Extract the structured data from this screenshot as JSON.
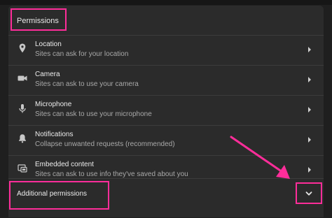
{
  "section": {
    "title": "Permissions"
  },
  "permissions": [
    {
      "title": "Location",
      "desc": "Sites can ask for your location",
      "icon": "location-pin-icon"
    },
    {
      "title": "Camera",
      "desc": "Sites can ask to use your camera",
      "icon": "camera-icon"
    },
    {
      "title": "Microphone",
      "desc": "Sites can ask to use your microphone",
      "icon": "microphone-icon"
    },
    {
      "title": "Notifications",
      "desc": "Collapse unwanted requests (recommended)",
      "icon": "bell-icon"
    },
    {
      "title": "Embedded content",
      "desc": "Sites can ask to use info they've saved about you",
      "icon": "embedded-content-icon"
    }
  ],
  "additional": {
    "title": "Additional permissions",
    "expand_icon": "chevron-down-icon"
  },
  "colors": {
    "highlight": "#ff2d9a",
    "panel": "#2b2b2b",
    "background": "#1f1f1f"
  }
}
